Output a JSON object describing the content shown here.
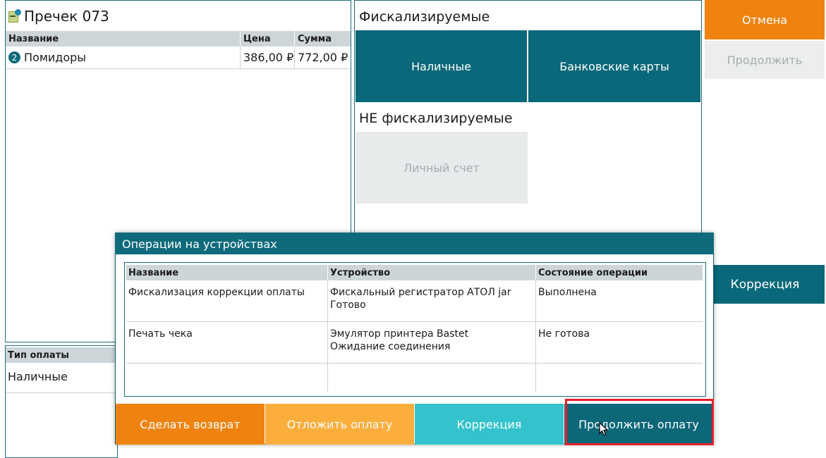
{
  "receipt": {
    "title": "Пречек 073",
    "columns": {
      "name": "Название",
      "price": "Цена",
      "sum": "Сумма"
    },
    "items": [
      {
        "qty": "2",
        "name": "Помидоры",
        "price": "386,00 ₽",
        "sum": "772,00 ₽"
      }
    ]
  },
  "payment_type": {
    "header": "Тип оплаты",
    "value": "Наличные"
  },
  "methods": {
    "fiscal_title": "Фискализируемые",
    "cash_label": "Наличные",
    "card_label": "Банковские карты",
    "nonfiscal_title": "НЕ фискализируемые",
    "account_label": "Личный счет"
  },
  "side_buttons": {
    "cancel": "Отмена",
    "continue": "Продолжить",
    "correction": "Коррекция"
  },
  "modal": {
    "title": "Операции на устройствах",
    "columns": {
      "name": "Название",
      "device": "Устройство",
      "status": "Состояние операции"
    },
    "rows": [
      {
        "name": "Фискализация коррекции оплаты",
        "device": "Фискальный регистратор АТОЛ jar",
        "device_status": "Готово",
        "status": "Выполнена"
      },
      {
        "name": "Печать чека",
        "device": "Эмулятор принтера Bastet",
        "device_status": "Ожидание соединения",
        "status": "Не готова"
      }
    ],
    "buttons": {
      "return": "Сделать возврат",
      "postpone": "Отложить оплату",
      "correction": "Коррекция",
      "continue": "Продолжить оплату"
    }
  },
  "colors": {
    "teal": "#096879",
    "orange": "#f0830f",
    "light_orange": "#fcae3c",
    "cyan": "#34c3cd",
    "highlight": "#e4222c"
  }
}
